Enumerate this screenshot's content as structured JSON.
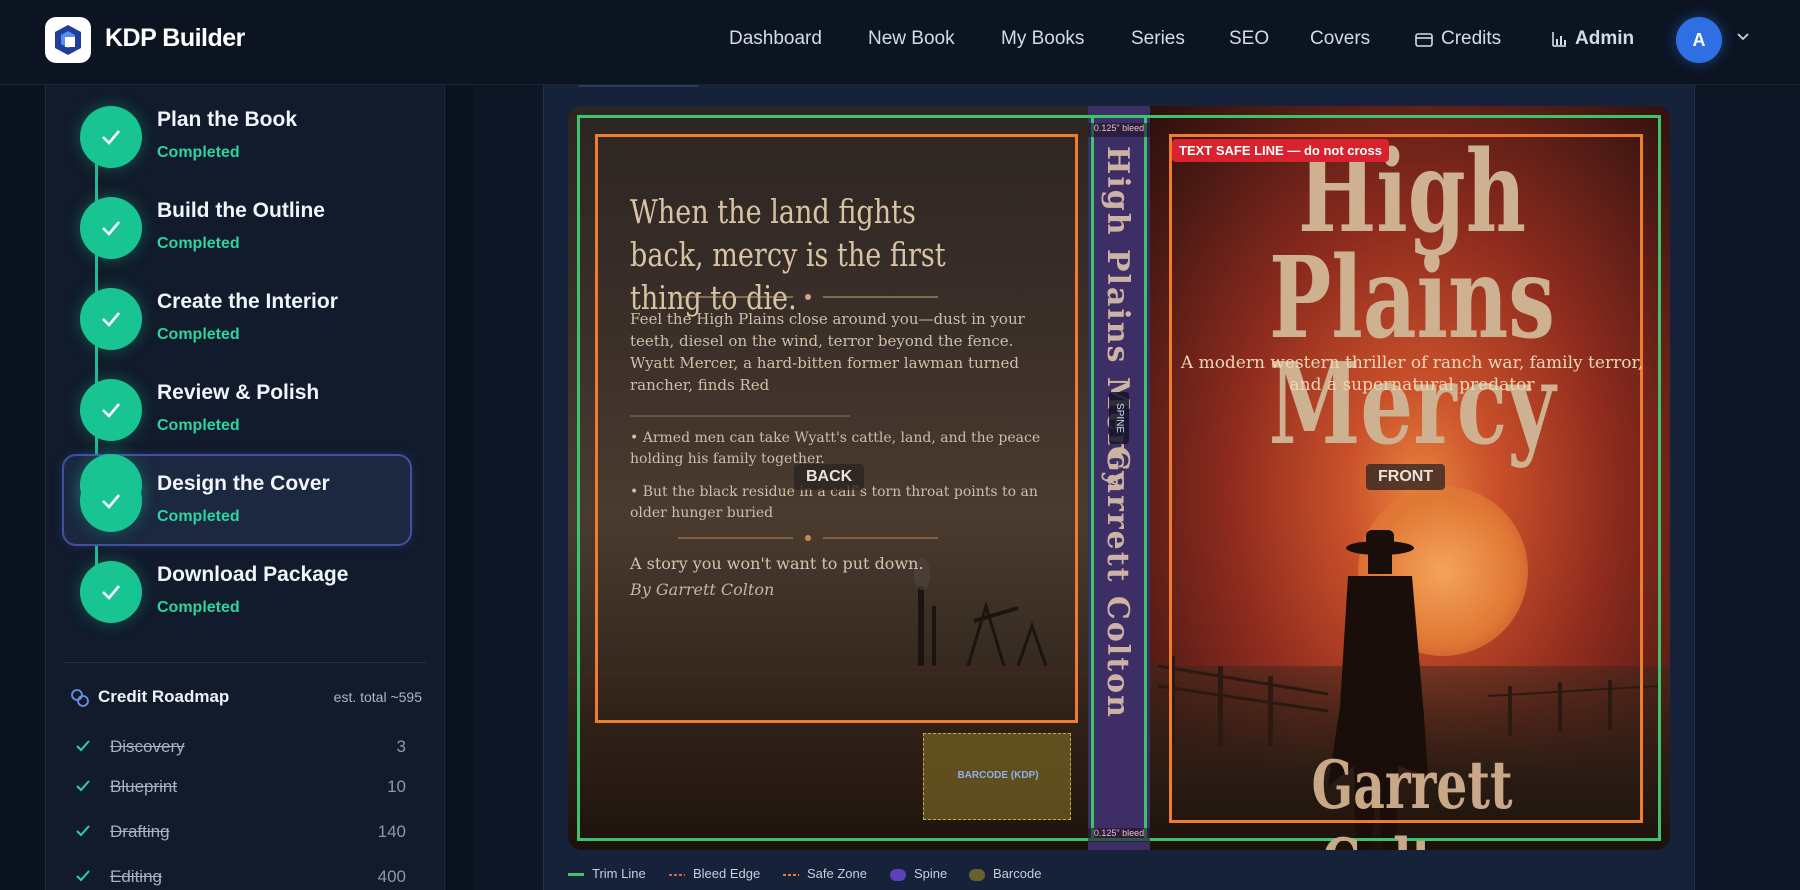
{
  "header": {
    "brand": "KDP Builder",
    "nav": [
      "Dashboard",
      "New Book",
      "My Books",
      "Series",
      "SEO",
      "Covers",
      "Credits",
      "Admin"
    ],
    "avatar_initial": "A"
  },
  "steps": [
    {
      "title": "Plan the Book",
      "status": "Completed"
    },
    {
      "title": "Build the Outline",
      "status": "Completed"
    },
    {
      "title": "Create the Interior",
      "status": "Completed"
    },
    {
      "title": "Review & Polish",
      "status": "Completed"
    },
    {
      "title": "Design the Cover",
      "status": "Completed",
      "active": true
    },
    {
      "title": "Download Package",
      "status": "Completed"
    }
  ],
  "roadmap": {
    "title": "Credit Roadmap",
    "total": "est. total ~595",
    "items": [
      {
        "name": "Discovery",
        "credits": "3"
      },
      {
        "name": "Blueprint",
        "credits": "10"
      },
      {
        "name": "Drafting",
        "credits": "140"
      },
      {
        "name": "Editing",
        "credits": "400"
      }
    ]
  },
  "cover": {
    "bleed_label": "0.125\" bleed",
    "safe_line_label": "TEXT SAFE LINE — do not cross",
    "back_label": "BACK",
    "front_label": "FRONT",
    "spine_label": "SPINE",
    "barcode_label": "BARCODE (KDP)",
    "back_headline": "When the land fights back, mercy is the first thing to die.",
    "back_body": "Feel the High Plains close around you—dust in your teeth, diesel on the wind, terror beyond the fence. Wyatt Mercer, a hard-bitten former lawman turned rancher, finds Red",
    "bullet_1": "• Armed men can take Wyatt's cattle, land, and the peace holding his family together.",
    "bullet_2": "• But the black residue in a calf's torn throat points to an older hunger buried",
    "tagline": "A story you won't want to put down.",
    "byline": "By Garrett Colton",
    "title_line_1": "High Plains",
    "title_line_2": "Mercy",
    "subtitle": "A modern western thriller of ranch war, family terror, and a supernatural predator",
    "author": "Garrett Colton",
    "spine_title": "High Plains Mercy",
    "spine_author": "Garrett Colton"
  },
  "legend": [
    "Trim Line",
    "Bleed Edge",
    "Safe Zone",
    "Spine",
    "Barcode"
  ],
  "colors": {
    "trim": "#3cc46c",
    "safe": "#f07c2c",
    "accent": "#19c493",
    "spine": "#6a4fc7"
  }
}
